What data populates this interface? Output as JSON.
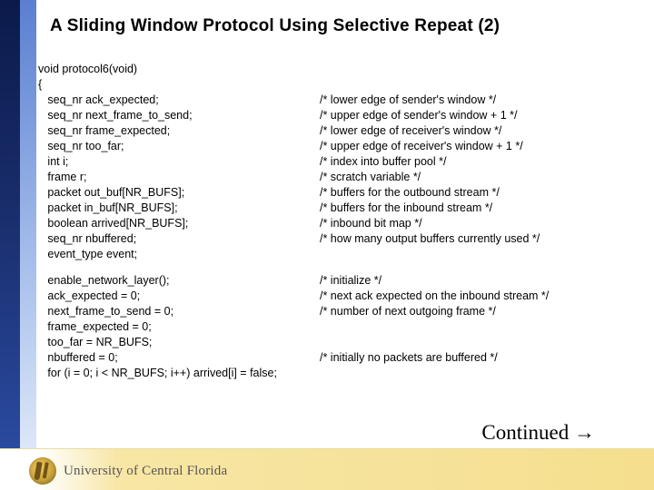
{
  "title": "A Sliding Window Protocol Using Selective Repeat (2)",
  "sig": [
    "void protocol6(void)",
    "{"
  ],
  "decl": [
    {
      "c": "   seq_nr ack_expected;",
      "m": "/* lower edge of sender's window */"
    },
    {
      "c": "   seq_nr next_frame_to_send;",
      "m": "/* upper edge of sender's window + 1 */"
    },
    {
      "c": "   seq_nr frame_expected;",
      "m": "/* lower edge of receiver's window */"
    },
    {
      "c": "   seq_nr too_far;",
      "m": "/* upper edge of receiver's window + 1 */"
    },
    {
      "c": "   int i;",
      "m": "/* index into buffer pool */"
    },
    {
      "c": "   frame r;",
      "m": "/* scratch variable */"
    },
    {
      "c": "   packet out_buf[NR_BUFS];",
      "m": "/* buffers for the outbound stream */"
    },
    {
      "c": "   packet in_buf[NR_BUFS];",
      "m": "/* buffers for the inbound stream */"
    },
    {
      "c": "   boolean arrived[NR_BUFS];",
      "m": "/* inbound bit map */"
    },
    {
      "c": "   seq_nr nbuffered;",
      "m": "/* how many output buffers currently used */"
    },
    {
      "c": "   event_type event;",
      "m": ""
    }
  ],
  "init": [
    {
      "c": "   enable_network_layer();",
      "m": "/* initialize */"
    },
    {
      "c": "   ack_expected = 0;",
      "m": "/* next ack expected on the inbound stream */"
    },
    {
      "c": "   next_frame_to_send = 0;",
      "m": "/* number of next outgoing frame */"
    },
    {
      "c": "   frame_expected = 0;",
      "m": ""
    },
    {
      "c": "   too_far = NR_BUFS;",
      "m": ""
    },
    {
      "c": "   nbuffered = 0;",
      "m": "/* initially no packets are buffered */"
    },
    {
      "c": "   for (i = 0; i < NR_BUFS; i++) arrived[i] = false;",
      "m": ""
    }
  ],
  "continued": "Continued →",
  "footer": {
    "org": "University of Central Florida"
  }
}
